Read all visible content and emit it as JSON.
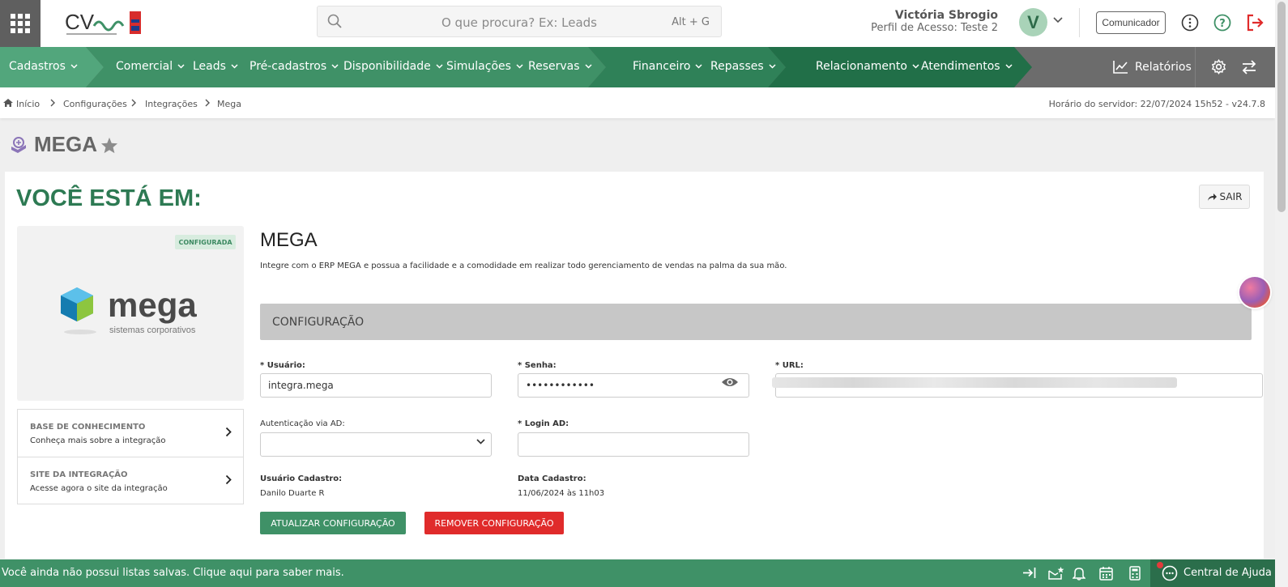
{
  "header": {
    "search_placeholder": "O que procura? Ex: Leads",
    "search_shortcut": "Alt + G",
    "user_name": "Victória Sbrogio",
    "user_profile": "Perfil de Acesso: Teste 2",
    "avatar_letter": "V",
    "communicator_label": "Comunicador"
  },
  "nav": {
    "items": [
      "Cadastros",
      "Comercial",
      "Leads",
      "Pré-cadastros",
      "Disponibilidade",
      "Simulações",
      "Reservas",
      "Financeiro",
      "Repasses",
      "Relacionamento",
      "Atendimentos"
    ],
    "reports": "Relatórios"
  },
  "breadcrumb": {
    "items": [
      "Início",
      "Configurações",
      "Integrações",
      "Mega"
    ],
    "server_time": "Horário do servidor: 22/07/2024 15h52 - v24.7.8"
  },
  "page": {
    "title": "MEGA",
    "you_are_in": "VOCÊ ESTÁ EM:",
    "exit_label": "SAIR"
  },
  "integration": {
    "status_badge": "CONFIGURADA",
    "logo_word": "mega",
    "logo_tagline": "sistemas corporativos",
    "title": "MEGA",
    "description": "Integre com o ERP MEGA e possua a facilidade e a comodidade em realizar todo gerenciamento de vendas na palma da sua mão.",
    "links": [
      {
        "title": "BASE DE CONHECIMENTO",
        "subtitle": "Conheça mais sobre a integração"
      },
      {
        "title": "SITE DA INTEGRAÇÃO",
        "subtitle": "Acesse agora o site da integração"
      }
    ]
  },
  "config": {
    "section_title": "CONFIGURAÇÃO",
    "user_label": "* Usuário:",
    "user_value": "integra.mega",
    "password_label": "* Senha:",
    "password_value": "••••••••••••",
    "url_label": "* URL:",
    "ad_auth_label": "Autenticação via AD:",
    "ad_login_label": "* Login AD:",
    "created_by_label": "Usuário Cadastro:",
    "created_by_value": "Danilo Duarte R",
    "created_date_label": "Data Cadastro:",
    "created_date_value": "11/06/2024 às 11h03",
    "update_button": "ATUALIZAR CONFIGURAÇÃO",
    "remove_button": "REMOVER CONFIGURAÇÃO"
  },
  "footer": {
    "saved_lists_text": "Você ainda não possui listas salvas. Clique aqui para saber mais.",
    "help_center": "Central de Ajuda"
  },
  "colors": {
    "brand_green": "#3f9167",
    "danger_red": "#e02b2b",
    "title_green": "#2d7a53"
  }
}
